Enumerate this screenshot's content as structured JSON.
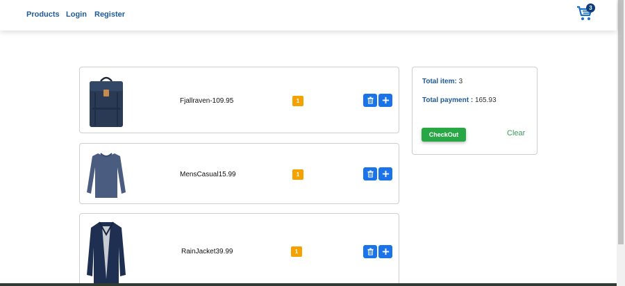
{
  "nav": {
    "products": "Products",
    "login": "Login",
    "register": "Register",
    "cart_count": "3"
  },
  "cart_items": [
    {
      "name": "Fjallraven-109.95",
      "qty": "1",
      "icon": "backpack"
    },
    {
      "name": "MensCasual15.99",
      "qty": "1",
      "icon": "long-sleeve-shirt"
    },
    {
      "name": "RainJacket39.99",
      "qty": "1",
      "icon": "rain-jacket"
    }
  ],
  "summary": {
    "total_item_label": "Total item:",
    "total_item_value": "3",
    "total_payment_label": "Total payment :",
    "total_payment_value": "165.93",
    "checkout_label": "CheckOut",
    "clear_label": "Clear"
  },
  "colors": {
    "nav_text": "#1e5a96",
    "qty_badge": "#f5a100",
    "action_button": "#1a73e8",
    "checkout_button": "#28a745",
    "clear_text": "#3a9a5b"
  }
}
